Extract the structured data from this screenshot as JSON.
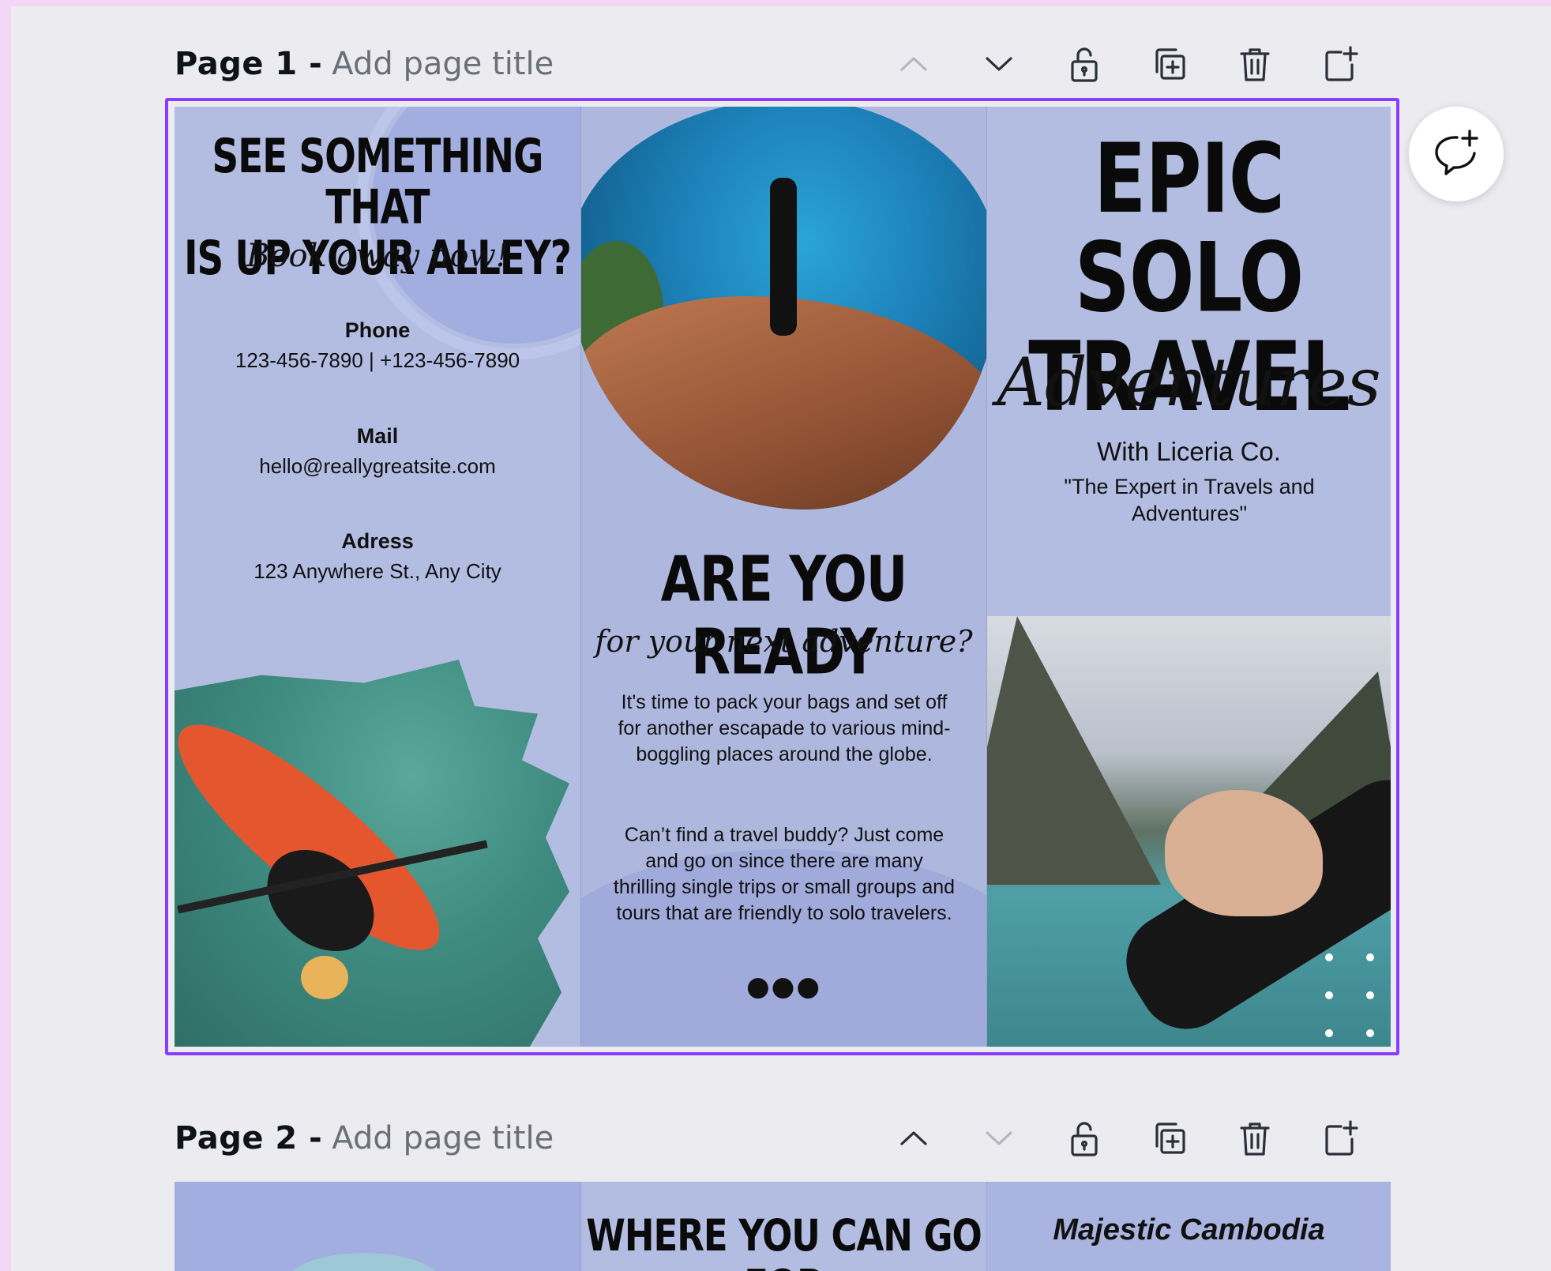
{
  "pages": [
    {
      "label": "Page 1 -",
      "title_placeholder": "Add page title",
      "tools": {
        "move_up": {
          "icon": "chevron-up-icon",
          "enabled": false
        },
        "move_down": {
          "icon": "chevron-down-icon",
          "enabled": true
        },
        "lock": {
          "icon": "lock-icon"
        },
        "duplicate": {
          "icon": "duplicate-icon"
        },
        "delete": {
          "icon": "trash-icon"
        },
        "add_page": {
          "icon": "add-page-icon"
        }
      }
    },
    {
      "label": "Page 2 -",
      "title_placeholder": "Add page title",
      "tools": {
        "move_up": {
          "icon": "chevron-up-icon",
          "enabled": true
        },
        "move_down": {
          "icon": "chevron-down-icon",
          "enabled": false
        },
        "lock": {
          "icon": "lock-icon"
        },
        "duplicate": {
          "icon": "duplicate-icon"
        },
        "delete": {
          "icon": "trash-icon"
        },
        "add_page": {
          "icon": "add-page-icon"
        }
      }
    }
  ],
  "comment_button": {
    "icon": "add-comment-icon"
  },
  "brochure": {
    "panel1": {
      "headline_line1": "SEE SOMETHING THAT",
      "headline_line2": "IS UP YOUR ALLEY?",
      "script": "Book away now!",
      "phone_label": "Phone",
      "phone_value": "123-456-7890 | +123-456-7890",
      "mail_label": "Mail",
      "mail_value": "hello@reallygreatsite.com",
      "address_label": "Adress",
      "address_value": "123 Anywhere St., Any City"
    },
    "panel2": {
      "headline": "ARE YOU READY",
      "script": "for your next adventure?",
      "para1": "It's time to pack your bags and set off for another escapade to various mind-boggling places around the globe.",
      "para2": "Can’t find a travel buddy? Just come and go on since there are many thrilling single trips or small groups and tours that are friendly to solo travelers.",
      "dots": "●●●"
    },
    "panel3": {
      "headline_line1": "EPIC SOLO",
      "headline_line2": "TRAVEL",
      "script": "Adventures",
      "with": "With Liceria Co.",
      "quote": "\"The Expert in Travels and Adventures\""
    }
  },
  "page2_preview": {
    "panel2_headline": "WHERE YOU CAN GO FOR",
    "panel3_headline": "Majestic Cambodia"
  },
  "colors": {
    "selection": "#8b3dff",
    "brochure_bg": "#b3bde2",
    "workspace_bg": "#ececf0"
  }
}
